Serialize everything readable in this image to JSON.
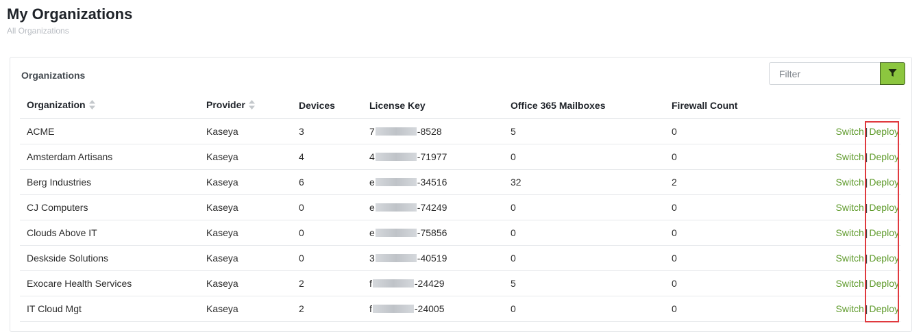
{
  "header": {
    "title": "My Organizations",
    "subtitle": "All Organizations"
  },
  "panel": {
    "title": "Organizations",
    "filter_placeholder": "Filter",
    "filter_icon": "filter-funnel-icon",
    "accent_color": "#8cc63f"
  },
  "table": {
    "columns": {
      "organization": "Organization",
      "provider": "Provider",
      "devices": "Devices",
      "license_key": "License Key",
      "office365": "Office 365 Mailboxes",
      "firewall": "Firewall Count"
    },
    "sort_icon": "sort-updown-icon",
    "actions": {
      "switch": "Switch",
      "separator": "|",
      "deploy": "Deploy"
    },
    "rows": [
      {
        "organization": "ACME",
        "provider": "Kaseya",
        "devices": "3",
        "license_prefix": "7",
        "license_suffix": "-8528",
        "office365": "5",
        "firewall": "0"
      },
      {
        "organization": "Amsterdam Artisans",
        "provider": "Kaseya",
        "devices": "4",
        "license_prefix": "4",
        "license_suffix": "-71977",
        "office365": "0",
        "firewall": "0"
      },
      {
        "organization": "Berg Industries",
        "provider": "Kaseya",
        "devices": "6",
        "license_prefix": "e",
        "license_suffix": "-34516",
        "office365": "32",
        "firewall": "2"
      },
      {
        "organization": "CJ Computers",
        "provider": "Kaseya",
        "devices": "0",
        "license_prefix": "e",
        "license_suffix": "-74249",
        "office365": "0",
        "firewall": "0"
      },
      {
        "organization": "Clouds Above IT",
        "provider": "Kaseya",
        "devices": "0",
        "license_prefix": "e",
        "license_suffix": "-75856",
        "office365": "0",
        "firewall": "0"
      },
      {
        "organization": "Deskside Solutions",
        "provider": "Kaseya",
        "devices": "0",
        "license_prefix": "3",
        "license_suffix": "-40519",
        "office365": "0",
        "firewall": "0"
      },
      {
        "organization": "Exocare Health Services",
        "provider": "Kaseya",
        "devices": "2",
        "license_prefix": "f",
        "license_suffix": "-24429",
        "office365": "5",
        "firewall": "0"
      },
      {
        "organization": "IT Cloud Mgt",
        "provider": "Kaseya",
        "devices": "2",
        "license_prefix": "f",
        "license_suffix": "-24005",
        "office365": "0",
        "firewall": "0"
      }
    ]
  },
  "colors": {
    "link": "#5e9a2a",
    "highlight": "#e0393e"
  }
}
